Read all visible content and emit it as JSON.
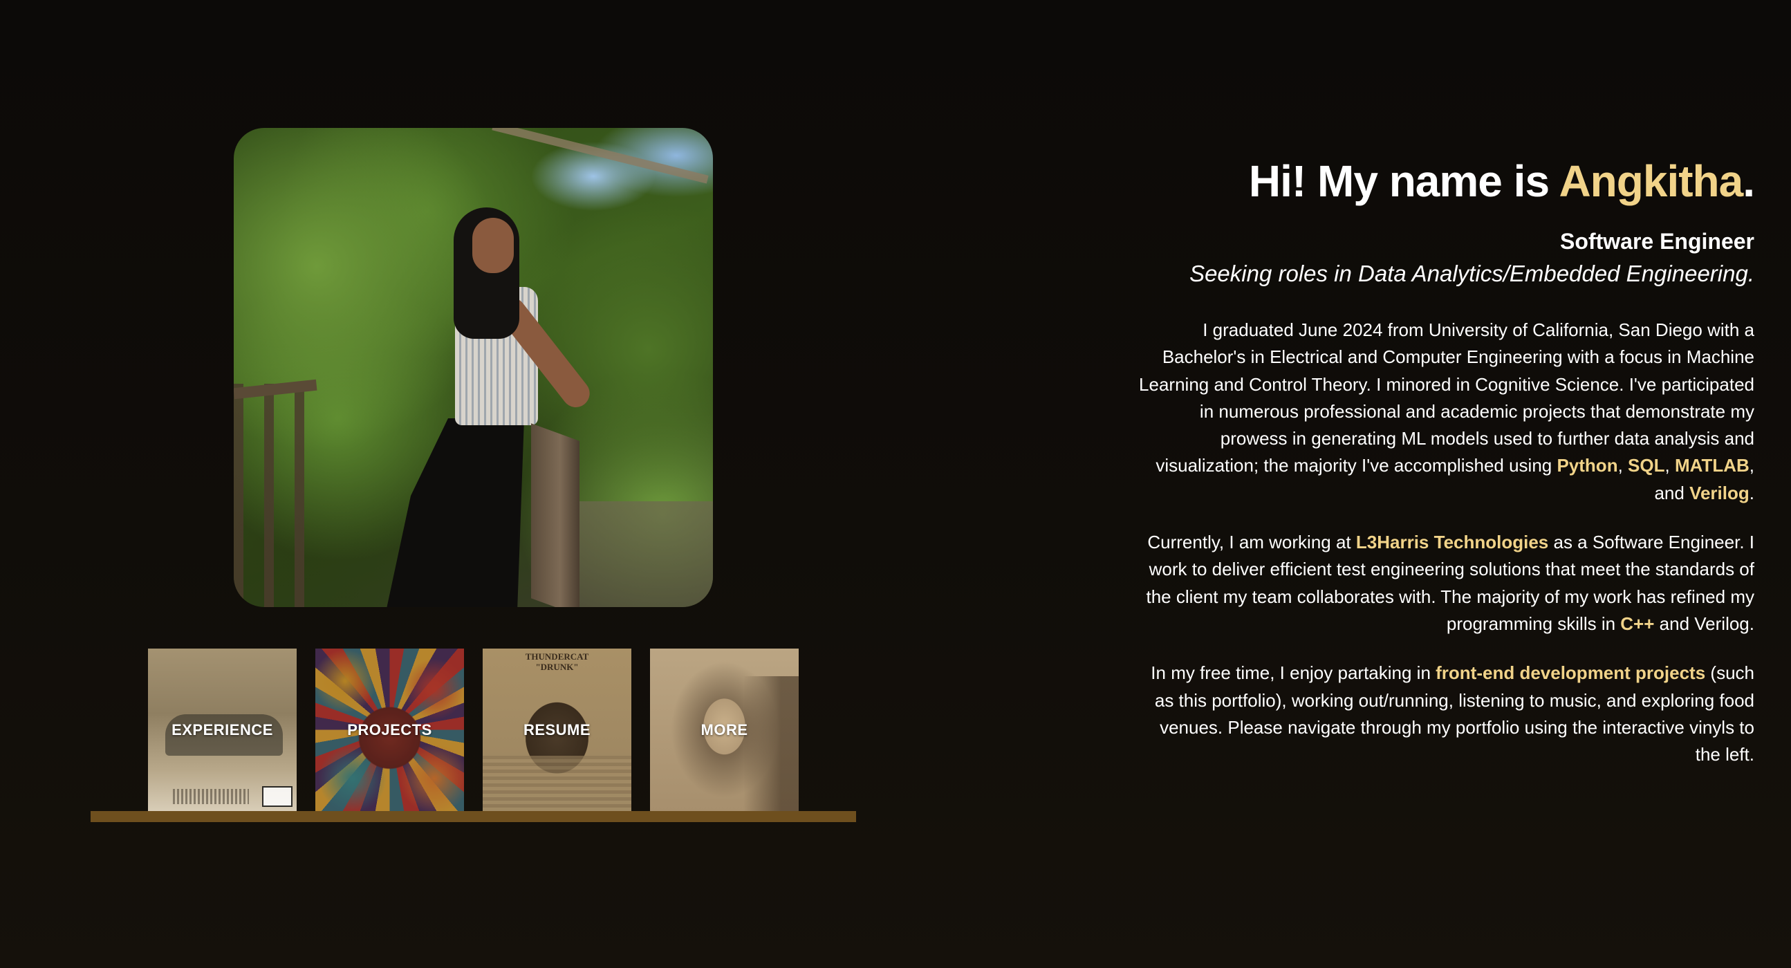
{
  "intro": {
    "greeting_prefix": "Hi! My name is ",
    "name": "Angkitha",
    "greeting_suffix": ".",
    "role": "Software Engineer",
    "seeking": "Seeking roles in Data Analytics/Embedded Engineering."
  },
  "about": {
    "p1_text": "I graduated June 2024 from University of California, San Diego with a Bachelor's in Electrical and Computer Engineering with a focus in Machine Learning and Control Theory. I minored in Cognitive Science. I've participated in numerous professional and academic projects that demonstrate my prowess in generating ML models used to further data analysis and visualization; the majority I've accomplished using ",
    "p1_skill_1": "Python",
    "p1_sep_1": ", ",
    "p1_skill_2": "SQL",
    "p1_sep_2": ", ",
    "p1_skill_3": "MATLAB",
    "p1_sep_3": ", and ",
    "p1_skill_4": "Verilog",
    "p1_end": ".",
    "p2_text_a": "Currently, I am working at ",
    "p2_company": "L3Harris Technologies",
    "p2_text_b": " as a Software Engineer. I work to deliver efficient test engineering solutions that meet the standards of the client my team collaborates with. The majority of my work has refined my programming skills in ",
    "p2_skill": "C++",
    "p2_text_c": " and Verilog.",
    "p3_text_a": "In my free time, I enjoy partaking in ",
    "p3_highlight": "front-end development projects",
    "p3_text_b": " (such as this portfolio), working out/running, listening to music, and exploring food venues. Please navigate through my portfolio using the interactive vinyls to the left."
  },
  "vinyls": [
    {
      "label": "EXPERIENCE"
    },
    {
      "label": "PROJECTS"
    },
    {
      "label": "RESUME",
      "cover_title_line1": "THUNDERCAT",
      "cover_title_line2": "\"DRUNK\""
    },
    {
      "label": "MORE"
    }
  ],
  "colors": {
    "accent": "#f1d389",
    "background": "#0e0b08",
    "shelf": "#6e4f1e"
  }
}
